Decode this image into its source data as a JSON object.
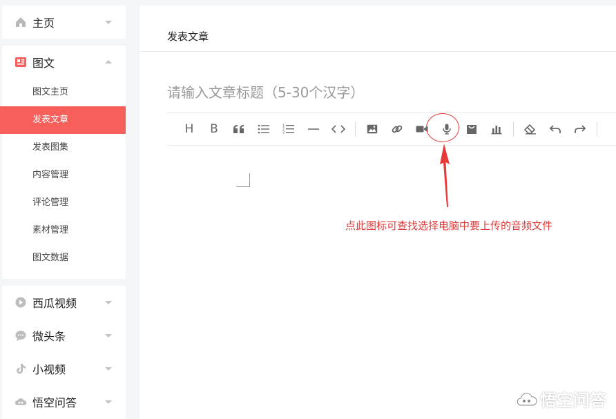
{
  "sidebar": {
    "home": {
      "label": "主页",
      "icon": "home-icon"
    },
    "tuwen": {
      "label": "图文",
      "icon": "article-icon",
      "items": [
        {
          "label": "图文主页"
        },
        {
          "label": "发表文章",
          "active": true
        },
        {
          "label": "发表图集"
        },
        {
          "label": "内容管理"
        },
        {
          "label": "评论管理"
        },
        {
          "label": "素材管理"
        },
        {
          "label": "图文数据"
        }
      ]
    },
    "others": [
      {
        "label": "西瓜视频",
        "icon": "xigua-video-icon"
      },
      {
        "label": "微头条",
        "icon": "chat-bubble-icon"
      },
      {
        "label": "小视频",
        "icon": "music-note-icon"
      },
      {
        "label": "悟空问答",
        "icon": "cloud-qa-icon"
      }
    ]
  },
  "main": {
    "title": "发表文章",
    "title_placeholder": "请输入文章标题（5-30个汉字）",
    "toolbar": {
      "heading": "H",
      "bold": "B"
    }
  },
  "annotation": {
    "text": "点此图标可查找选择电脑中要上传的音频文件",
    "color": "#e03c3c"
  },
  "watermark": {
    "text": "悟空问答"
  },
  "colors": {
    "accent": "#f75f5b",
    "annotation": "#e63a3a"
  }
}
